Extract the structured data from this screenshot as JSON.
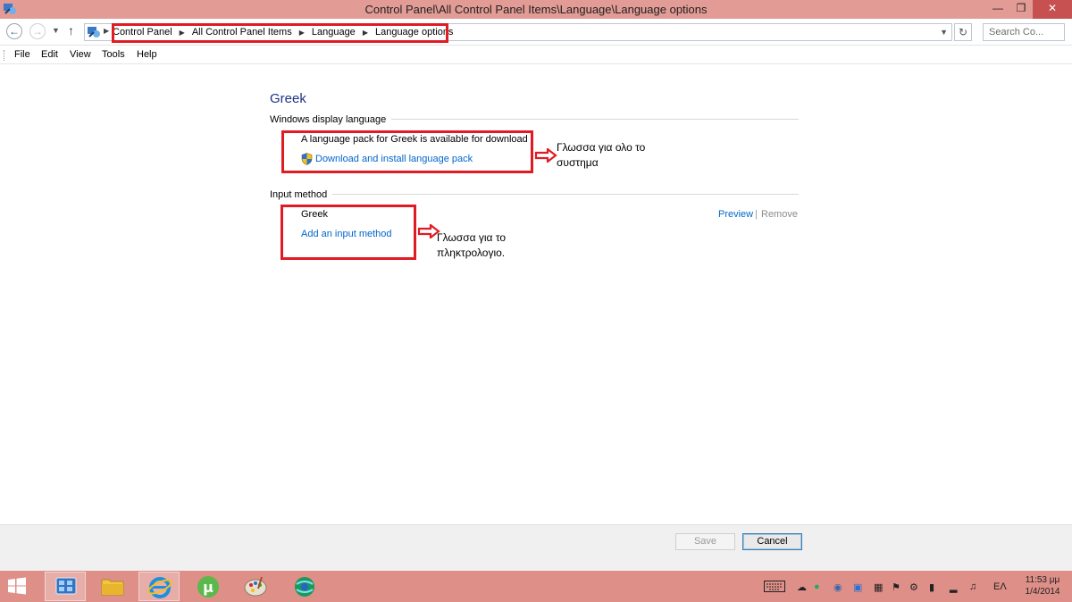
{
  "window": {
    "title": "Control Panel\\All Control Panel Items\\Language\\Language options",
    "minimize": "—",
    "maximize": "❐",
    "close": "✕"
  },
  "address": {
    "crumbs": [
      "Control Panel",
      "All Control Panel Items",
      "Language",
      "Language options"
    ],
    "search_placeholder": "Search Co..."
  },
  "menu": [
    "File",
    "Edit",
    "View",
    "Tools",
    "Help"
  ],
  "page": {
    "heading": "Greek",
    "display_section": {
      "label": "Windows display language",
      "message": "A language pack for Greek is available for download",
      "link": "Download and install language pack"
    },
    "input_section": {
      "label": "Input method",
      "method_name": "Greek",
      "add_link": "Add an input method",
      "preview": "Preview",
      "separator": "|",
      "remove": "Remove"
    }
  },
  "annotations": {
    "display_note_line1": "Γλωσσα για ολο το",
    "display_note_line2": "συστημα",
    "input_note_line1": "Γλωσσα για το",
    "input_note_line2": "πληκτρολογιο.",
    "highlight_color": "#e01b24"
  },
  "buttons": {
    "save": "Save",
    "cancel": "Cancel"
  },
  "taskbar": {
    "language": "ΕΛ",
    "time": "11:53 μμ",
    "date": "1/4/2014",
    "color": "#de8f88"
  },
  "colors": {
    "titlebar": "#e29b95",
    "heading": "#1e3287",
    "link": "#0066cc"
  }
}
